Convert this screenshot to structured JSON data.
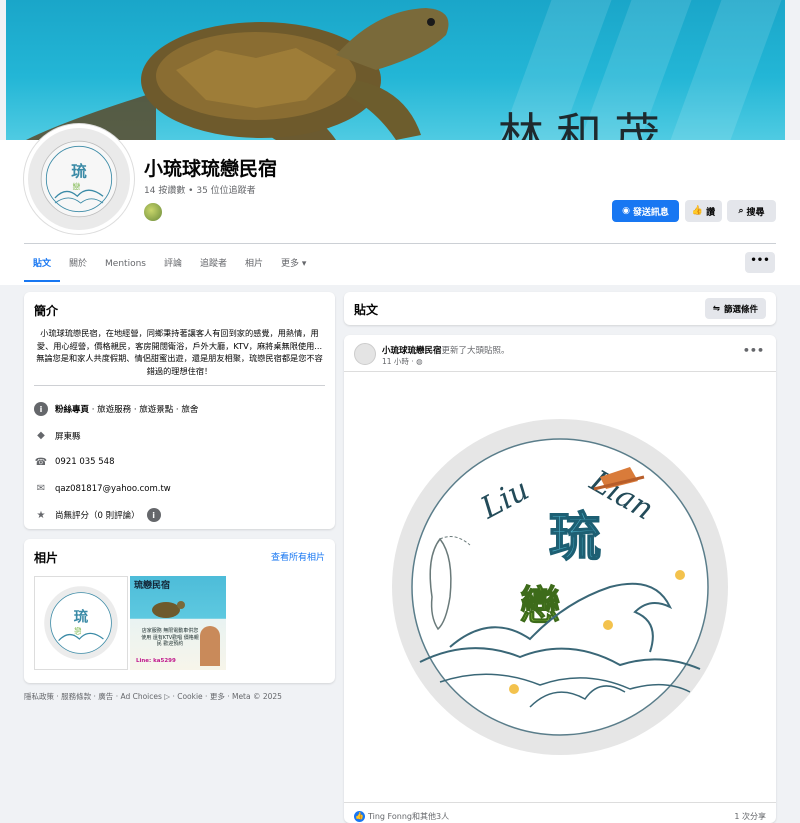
{
  "cover": {
    "overlay_text": "林和茂"
  },
  "page": {
    "name": "小琉球琉戀民宿",
    "stats": "14 按讚數 • 35 位位追蹤者"
  },
  "actions": {
    "message": "發送訊息",
    "like": "讚",
    "search": "搜尋",
    "more": "•••"
  },
  "tabs": [
    "貼文",
    "關於",
    "Mentions",
    "評論",
    "追蹤者",
    "相片",
    "更多 ▾"
  ],
  "intro": {
    "title": "簡介",
    "description": "小琉球琉戀民宿，在地經營，同鄉秉持著讓客人有回到家的感覺，用熱情，用愛、用心經營，價格親民，客房開闊衛浴，戶外大廳，KTV，麻將桌無限使用...無論您是和家人共度假期、情侶甜蜜出遊，還是朋友相聚，琉戀民宿都是您不容錯過的理想住宿！",
    "category_label": "粉絲專頁",
    "category_value": " · 旅遊服務 · 旅遊景點 · 旅舍",
    "location": "屏東縣",
    "phone": "0921 035 548",
    "email": "qaz081817@yahoo.com.tw",
    "rating": "尚無評分（0 則評論）"
  },
  "photos": {
    "title": "相片",
    "see_all": "查看所有相片",
    "thumb2_title": "琉戀民宿",
    "thumb2_text": "店家服務 無限電動車供您使用 還有KTV歡唱 價格親民 歡迎預約",
    "thumb2_line": "Line: ka5299"
  },
  "footer": "隱私政策 · 服務條款 · 廣告 · Ad Choices ▷ · Cookie · 更多 · Meta © 2025",
  "posts": {
    "title": "貼文",
    "filter": "篩選條件"
  },
  "post": {
    "author": "小琉球琉戀民宿",
    "action": "更新了大頭貼照。",
    "time": "11 小時 · ◍",
    "menu": "•••",
    "logo_text_left": "Liu",
    "logo_text_right": "Lian",
    "logo_char1": "琉",
    "logo_char2": "戀",
    "reactions": "Ting Fonng和其他3人",
    "shares": "1 次分享"
  },
  "colors": {
    "accent": "#1877f2",
    "logo_blue": "#3a8aa6",
    "logo_green": "#7ab648",
    "logo_gray": "#e6e6e6"
  }
}
